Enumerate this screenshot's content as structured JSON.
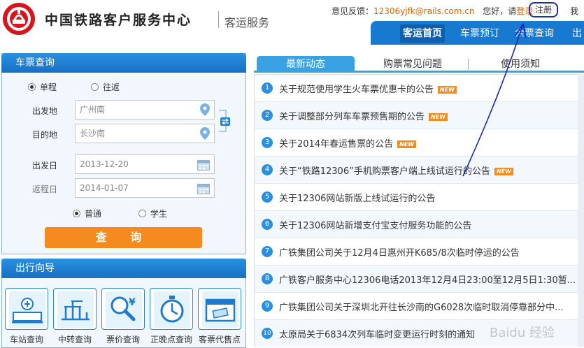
{
  "header": {
    "brand": "中国铁路客户服务中心",
    "sub_brand": "客运服务",
    "feedback_label": "意见反馈：",
    "feedback_email": "12306yjfk@rails.com.cn",
    "greeting": "您好，请",
    "login": "登录",
    "register": "注册",
    "tail": "我"
  },
  "nav": {
    "items": [
      {
        "label": "客运首页"
      },
      {
        "label": "车票预订"
      },
      {
        "label": "余票查询"
      },
      {
        "label": "出"
      }
    ]
  },
  "ticket_query": {
    "title": "车票查询",
    "trip_options": [
      "单程",
      "往返"
    ],
    "from_label": "出发地",
    "from_value": "广州南",
    "to_label": "目的地",
    "to_value": "长沙南",
    "depart_label": "出发日",
    "depart_value": "2013-12-20",
    "return_label": "返程日",
    "return_value": "2014-01-07",
    "passenger_options": [
      "普通",
      "学生"
    ],
    "search_button": "查 询"
  },
  "travel_guide": {
    "title": "出行向导",
    "items": [
      "车站查询",
      "中转查询",
      "票价查询",
      "正晚点查询",
      "客票代售点"
    ]
  },
  "tabs": [
    "最新动态",
    "购票常见问题",
    "使用须知"
  ],
  "news": [
    {
      "num": "1",
      "text": "关于规范使用学生火车票优惠卡的公告",
      "badge": "NEW"
    },
    {
      "num": "2",
      "text": "关于调整部分列车车票预售期的公告",
      "badge": "NEW"
    },
    {
      "num": "3",
      "text": "关于2014年春运售票的公告",
      "badge": "NEW"
    },
    {
      "num": "4",
      "text": "关于“铁路12306”手机购票客户端上线试运行的公告",
      "badge": "NEW"
    },
    {
      "num": "5",
      "text": "关于12306网站新版上线试运行的公告",
      "badge": ""
    },
    {
      "num": "6",
      "text": "关于12306网站新增支付宝支付服务功能的公告",
      "badge": ""
    },
    {
      "num": "7",
      "text": "广铁集团公司关于12月4日惠州开K685/8次临时停运的公告",
      "badge": ""
    },
    {
      "num": "8",
      "text": "广铁客户服务中心12306电话2013年12月4日23:00至12月5日1:30暂...",
      "badge": ""
    },
    {
      "num": "9",
      "text": "广铁集团公司关于深圳北开往长沙南的G6028次临时取消停靠部分中...",
      "badge": ""
    },
    {
      "num": "10",
      "text": "太原局关于6834次列车临时变更运行时刻的通知",
      "badge": ""
    }
  ],
  "watermark": "Baidu 经验",
  "colors": {
    "accent": "#1779cf",
    "orange": "#f58a1e",
    "logo_red": "#d6161d"
  }
}
